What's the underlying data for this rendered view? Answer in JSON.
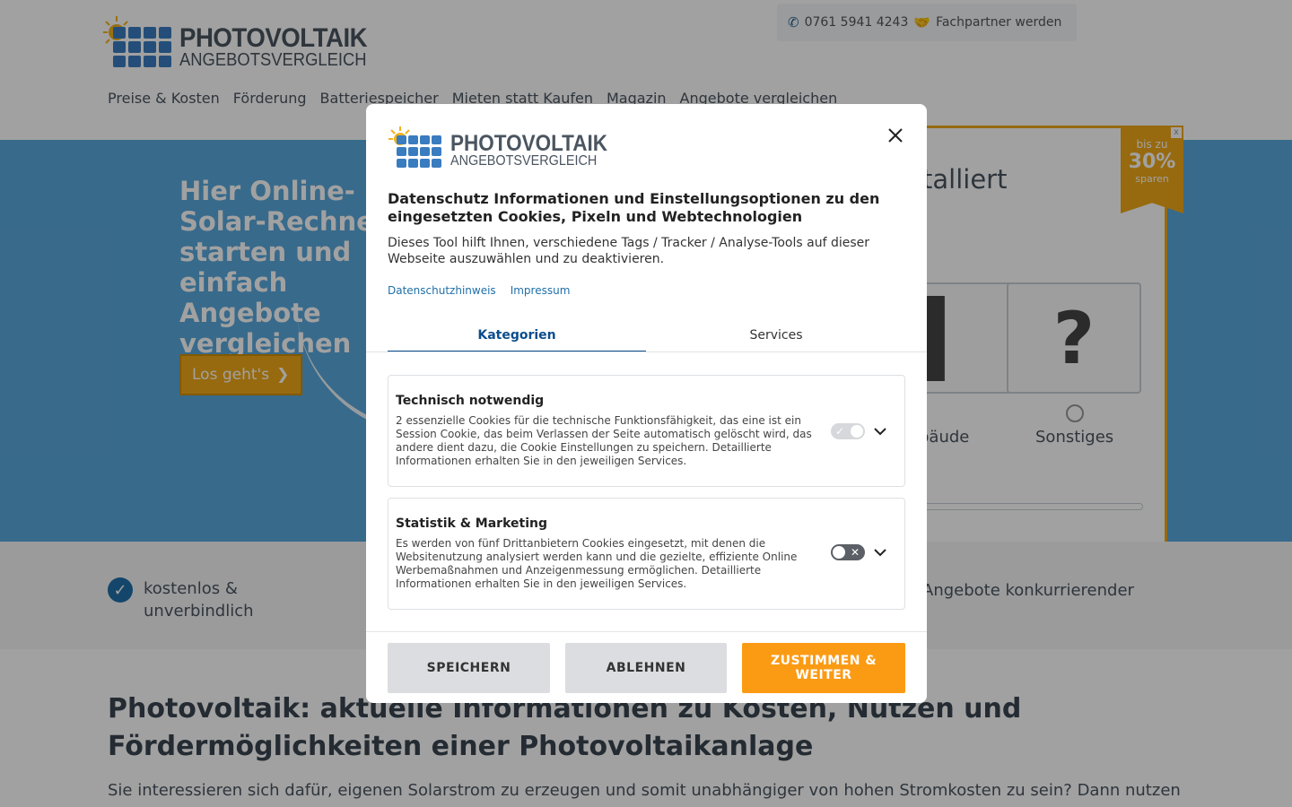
{
  "site": {
    "logo": {
      "title": "PHOTOVOLTAIK",
      "subtitle": "ANGEBOTSVERGLEICH"
    },
    "contact": {
      "phone": "0761 5941 4243",
      "partner_link": "Fachpartner werden"
    },
    "nav": [
      "Preise & Kosten",
      "Förderung",
      "Batteriespeicher",
      "Mieten statt Kaufen",
      "Magazin",
      "Angebote vergleichen"
    ],
    "hero": {
      "title": "Hier Online-Solar-Rechner starten und einfach Angebote vergleichen",
      "button": "Los geht's"
    },
    "calculator": {
      "heading": "tallier t",
      "options": [
        {
          "icon": "house-icon",
          "label": "bäude"
        },
        {
          "icon": "question-icon",
          "label": "Sonstiges",
          "glyph": "?"
        }
      ],
      "badge": {
        "line1": "bis zu",
        "line2": "30%",
        "line3": "sparen",
        "close": "x"
      }
    },
    "benefits": {
      "b1": "kostenlos & unverbindlich",
      "b3": "Angebote konkurrierender"
    },
    "main": {
      "heading": "Photovoltaik: aktuelle Informationen zu Kosten, Nutzen und Fördermöglichkeiten einer Photovoltaikanlage",
      "text": "Sie interessieren sich dafür, eigenen Solarstrom zu erzeugen und somit unabhängiger von hohen Stromkosten zu sein? Dann nutzen"
    }
  },
  "modal": {
    "logo": {
      "title": "PHOTOVOLTAIK",
      "subtitle": "ANGEBOTSVERGLEICH"
    },
    "title": "Datenschutz Informationen und Einstellungsoptionen zu den eingesetzten Cookies, Pixeln und Webtechnologien",
    "description": "Dieses Tool hilft Ihnen, verschiedene Tags / Tracker / Analyse-Tools auf dieser Webseite auszuwählen und zu deaktivieren.",
    "links": {
      "privacy": "Datenschutzhinweis",
      "imprint": "Impressum"
    },
    "tabs": {
      "categories": "Kategorien",
      "services": "Services"
    },
    "categories": [
      {
        "title": "Technisch notwendig",
        "text": "2 essenzielle Cookies für die technische Funktionsfähigkeit, das eine ist ein Session Cookie, das beim Verlassen der Seite automatisch gelöscht wird, das andere dient dazu, die Cookie Einstellungen zu speichern. Detaillierte Informationen erhalten Sie in den jeweiligen Services.",
        "toggle_mark": "✓",
        "enabled": true
      },
      {
        "title": "Statistik & Marketing",
        "text": "Es werden von fünf Drittanbietern Cookies eingesetzt, mit denen die Websitenutzung analysiert werden kann und die gezielte, effiziente Online Werbemaßnahmen und Anzeigenmessung ermöglichen. Detaillierte Informationen erhalten Sie in den jeweiligen Services.",
        "toggle_mark": "✕",
        "enabled": false
      }
    ],
    "buttons": {
      "save": "SPEICHERN",
      "reject": "ABLEHNEN",
      "accept": "ZUSTIMMEN & WEITER"
    }
  },
  "colors": {
    "accent": "#fb9b14",
    "primary": "#0b4d8c",
    "hero": "#5aa8dc",
    "link": "#1f6fa8"
  }
}
